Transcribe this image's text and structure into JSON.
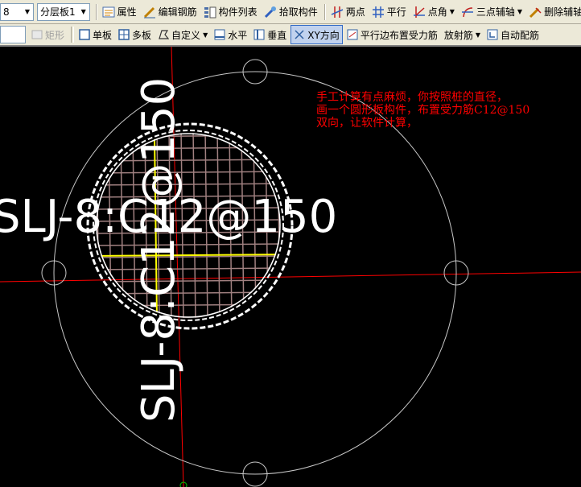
{
  "toolbar1": {
    "floor_value": "8",
    "layer_value": "分层板1",
    "properties": "属性",
    "edit_rebar": "编辑钢筋",
    "component_list": "构件列表",
    "pick_component": "拾取构件",
    "two_points": "两点",
    "parallel": "平行",
    "point_angle": "点角",
    "three_point_axis": "三点辅轴",
    "delete_axis": "删除辅轴"
  },
  "toolbar2": {
    "rectangle": "矩形",
    "single_slab": "单板",
    "multi_slab": "多板",
    "custom": "自定义",
    "horizontal": "水平",
    "vertical": "垂直",
    "xy_direction": "XY方向",
    "parallel_edge": "平行边布置受力筋",
    "radial": "放射筋",
    "auto_rebar": "自动配筋"
  },
  "canvas": {
    "annotation": "手工计算有点麻烦，你按照桩的直径，\n画一个圆形板构件，布置受力筋C12@150\n双向，让软件计算，",
    "label_horizontal": "SLJ-8:C12@150",
    "label_vertical": "SLJ-8:C12@150",
    "colors": {
      "background": "#000000",
      "axis": "#ff0000",
      "rebar_grid": "#a08080",
      "main_bar": "#ffff00",
      "outline": "#ffffff",
      "annotation": "#ff0000"
    }
  }
}
